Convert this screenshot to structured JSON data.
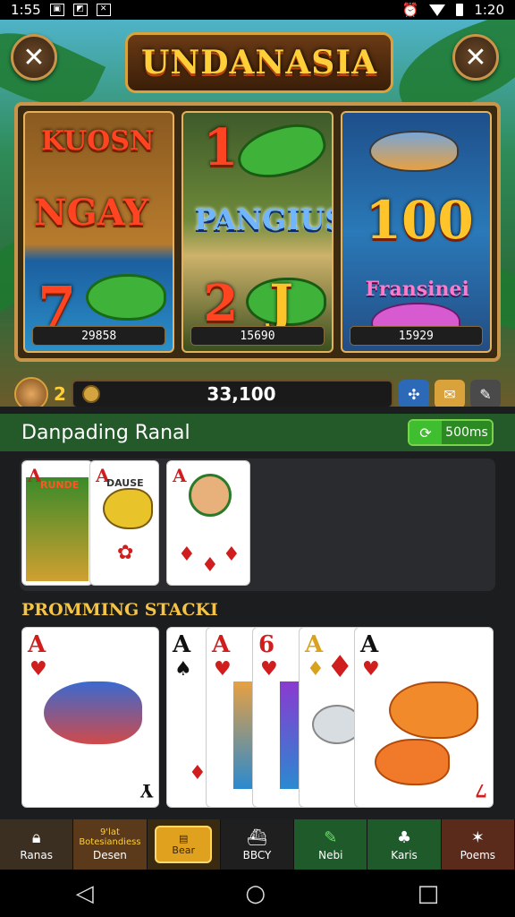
{
  "status": {
    "time": "1:55",
    "clock": "1:20"
  },
  "header": {
    "title": "UNDANASIA",
    "back_icon": "close-icon",
    "close_icon": "close-icon"
  },
  "reels": [
    {
      "texts": [
        "KUOSN",
        "NGAY",
        "7"
      ],
      "count": "29858"
    },
    {
      "texts": [
        "1",
        "PANGIUS",
        "2",
        "J"
      ],
      "count": "15690"
    },
    {
      "texts": [
        "100",
        "Fransinei"
      ],
      "count": "15929"
    }
  ],
  "balance": {
    "level": "2",
    "value": "33,100"
  },
  "section": {
    "title": "Danpading Ranal",
    "pill_label": "500ms"
  },
  "hand_cards": [
    {
      "rank": "A",
      "label": "RUNDE"
    },
    {
      "rank": "A",
      "label": "DAUSE"
    },
    {
      "rank": "A",
      "label": ""
    }
  ],
  "stack": {
    "title": "PROMMING STACKI",
    "cards": [
      {
        "rank": "A",
        "corner": "Y"
      },
      {
        "rank": "A",
        "corner": ""
      },
      {
        "rank": "A",
        "corner": ""
      },
      {
        "rank": "6",
        "corner": ""
      },
      {
        "rank": "A",
        "corner": ""
      },
      {
        "rank": "A",
        "corner": "7"
      }
    ]
  },
  "nav": [
    {
      "label": "Ranas",
      "icon": "lock-icon",
      "color": "#3b2f22"
    },
    {
      "label": "Desen",
      "sub": "9'lat Botesiandiess",
      "icon": "",
      "color": "#5a3a1a"
    },
    {
      "label": "Bear",
      "icon": "chest-icon",
      "color": "#e0a21e"
    },
    {
      "label": "BBCY",
      "icon": "ship-icon",
      "color": "#1f1f1f"
    },
    {
      "label": "Nebi",
      "icon": "wrench-icon",
      "color": "#1f5a2a"
    },
    {
      "label": "Karis",
      "icon": "tree-icon",
      "color": "#1f5a2a"
    },
    {
      "label": "Poems",
      "icon": "star-icon",
      "color": "#5a2a1a"
    }
  ],
  "colors": {
    "accent_gold": "#ffcf3a",
    "section_green": "#245a2a"
  }
}
